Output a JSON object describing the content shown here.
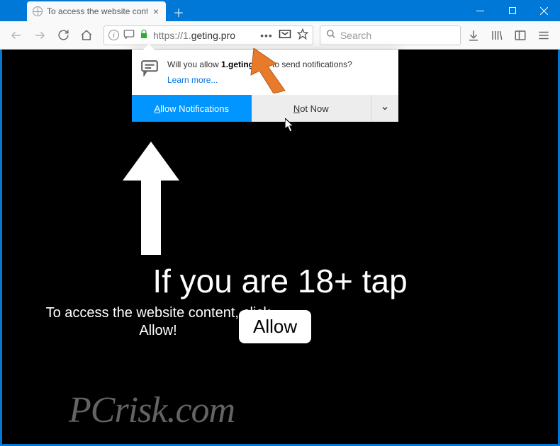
{
  "tab": {
    "title": "To access the website content, click"
  },
  "addr": {
    "prefix": "https://",
    "domain": "1.",
    "rest": "geting.pro"
  },
  "search": {
    "placeholder": "Search"
  },
  "perm": {
    "q1": "Will you allow ",
    "q_domain": "1.geting.pro",
    "q2": " to send notifications?",
    "learn": "Learn more...",
    "allow": "llow Notifications",
    "allow_u": "A",
    "not": "ot Now",
    "not_u": "N"
  },
  "page": {
    "big": "If you are 18+ tap",
    "sub": "To access the website content, click Allow!",
    "allow": "Allow"
  },
  "watermark": "PCrisk.com"
}
